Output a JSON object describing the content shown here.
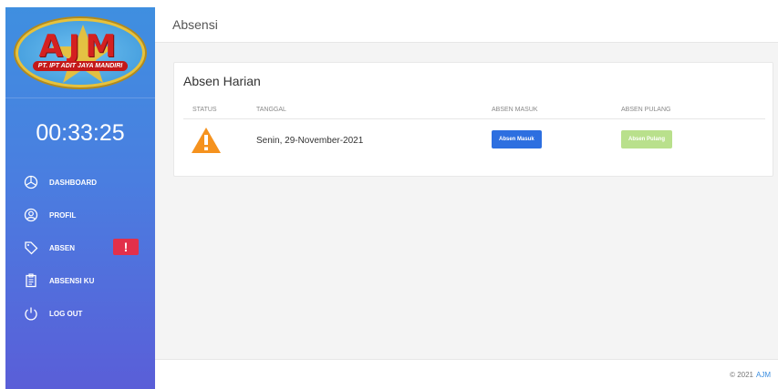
{
  "sidebar": {
    "logo": {
      "letters": "AJM",
      "tagline": "PT. IPT ADIT JAYA MANDIRI",
      "colors": {
        "oval": "#5ab0ea",
        "ring": "#e8c23a",
        "text": "#d42020"
      }
    },
    "clock": "00:33:25",
    "items": [
      {
        "label": "DASHBOARD",
        "icon": "dashboard-gauge-icon"
      },
      {
        "label": "PROFIL",
        "icon": "user-circle-icon"
      },
      {
        "label": "ABSEN",
        "icon": "tag-icon",
        "badge": "!"
      },
      {
        "label": "ABSENSI KU",
        "icon": "clipboard-icon"
      },
      {
        "label": "LOG OUT",
        "icon": "power-icon"
      }
    ],
    "gradient": [
      "#3f8fe0",
      "#5a5ed8"
    ]
  },
  "header": {
    "title": "Absensi"
  },
  "card": {
    "title": "Absen Harian",
    "columns": [
      "STATUS",
      "TANGGAL",
      "ABSEN MASUK",
      "ABSEN PULANG"
    ],
    "row": {
      "status_icon": "warning-triangle-icon",
      "date": "Senin, 29-November-2021",
      "masuk_label": "Absen Masuk",
      "pulang_label": "Absen Pulang"
    }
  },
  "footer": {
    "copyright": "© 2021",
    "brand": "AJM"
  },
  "colors": {
    "primary_button": "#2d6fe0",
    "disabled_button": "#b9e08c",
    "warning": "#f5921e",
    "alert_badge": "#e2304a"
  }
}
